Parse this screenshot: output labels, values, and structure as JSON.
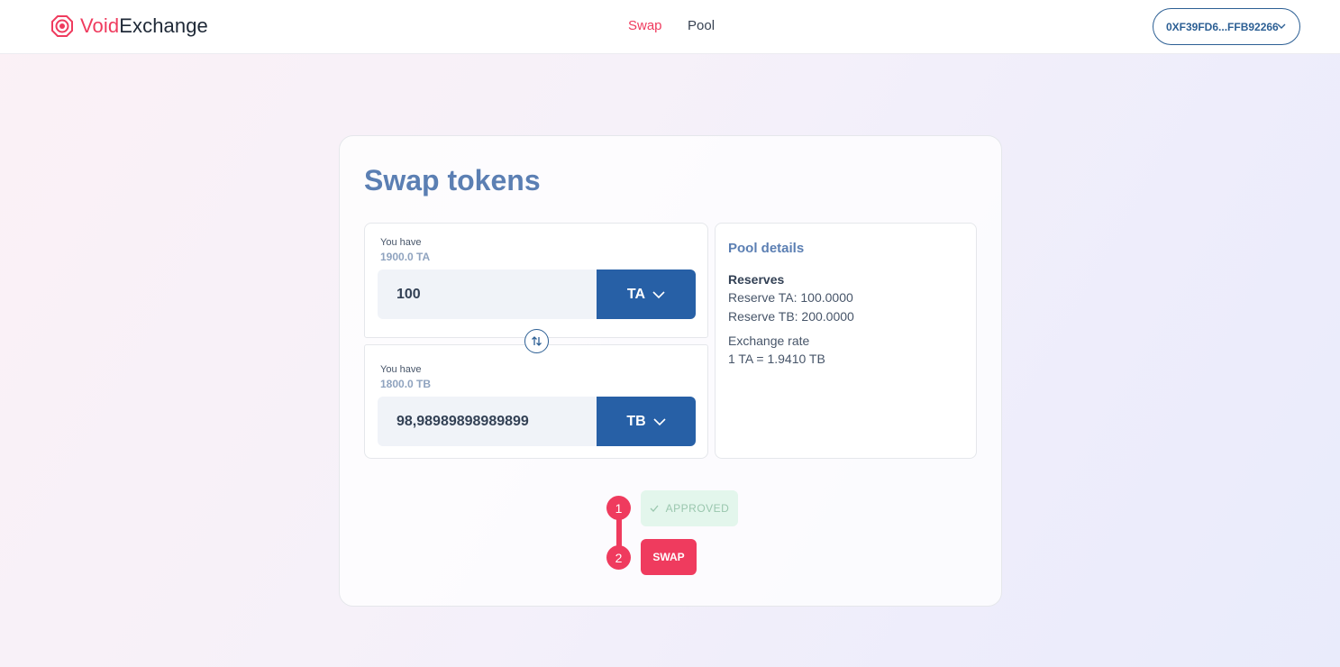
{
  "header": {
    "logo_prefix": "Void",
    "logo_suffix": "Exchange",
    "nav": {
      "swap": "Swap",
      "pool": "Pool"
    },
    "wallet_address": "0XF39FD6...FFB92266"
  },
  "card": {
    "title": "Swap tokens",
    "from": {
      "have_label": "You have",
      "balance": "1900.0 TA",
      "amount": "100",
      "token": "TA"
    },
    "to": {
      "have_label": "You have",
      "balance": "1800.0 TB",
      "amount": "98,98989898989899",
      "token": "TB"
    },
    "pool": {
      "title": "Pool details",
      "reserves_title": "Reserves",
      "reserve_a": "Reserve TA: 100.0000",
      "reserve_b": "Reserve TB: 200.0000",
      "rate_label": "Exchange rate",
      "rate_value": "1 TA = 1.9410 TB"
    },
    "steps": {
      "step1_number": "1",
      "step2_number": "2",
      "approved_label": "APPROVED",
      "swap_label": "SWAP"
    }
  },
  "colors": {
    "accent": "#ef3b5e",
    "primary": "#2760a6",
    "title": "#5b7fb3",
    "approved_bg": "#e3f6ec"
  }
}
